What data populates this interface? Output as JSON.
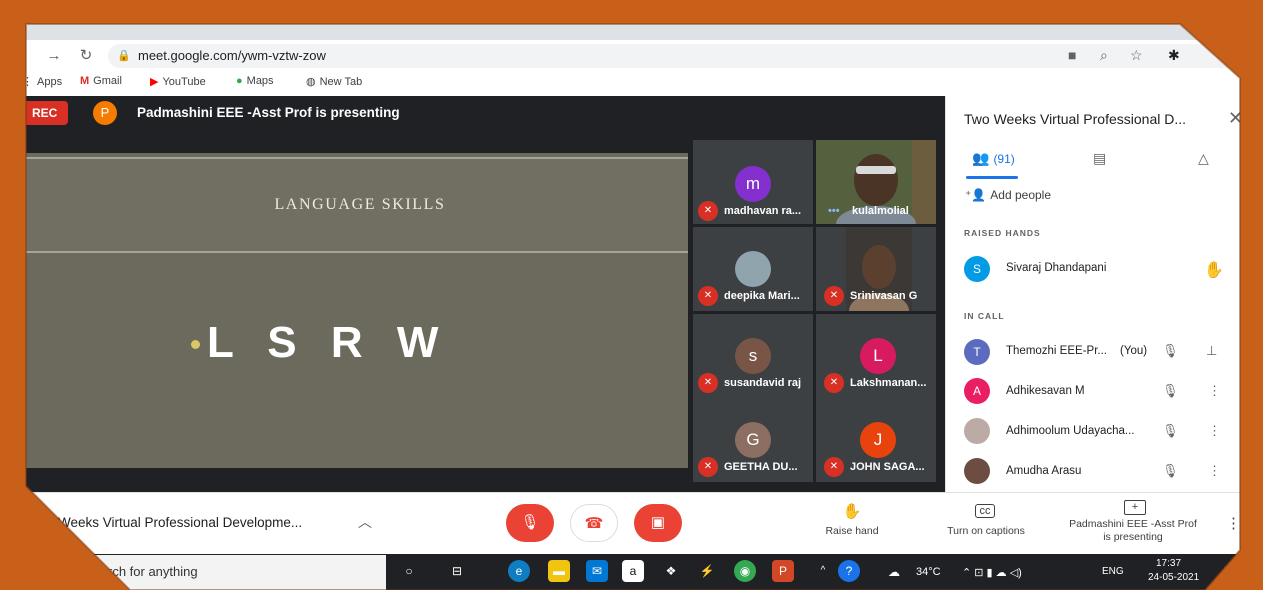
{
  "browser": {
    "url": "meet.google.com/ywm-vztw-zow",
    "bookmarks": [
      "Apps",
      "Gmail",
      "YouTube",
      "Maps",
      "New Tab"
    ]
  },
  "meet": {
    "rec_label": "REC",
    "presenter_initial": "P",
    "presenter_text": "Padmashini EEE -Asst Prof is presenting",
    "slide": {
      "title": "LANGUAGE SKILLS",
      "bullet": "L S R W"
    },
    "tiles": [
      {
        "initial": "m",
        "name": "madhavan ra...",
        "color": "#8430ce"
      },
      {
        "initial": "",
        "name": "kulalmolial",
        "color": ""
      },
      {
        "initial": "",
        "name": "deepika Mari...",
        "color": ""
      },
      {
        "initial": "",
        "name": "Srinivasan G",
        "color": ""
      },
      {
        "initial": "s",
        "name": "susandavid raj",
        "color": "#795548"
      },
      {
        "initial": "L",
        "name": "Lakshmanan...",
        "color": "#d81b60"
      },
      {
        "initial": "G",
        "name": "GEETHA DU...",
        "color": "#8d6e63"
      },
      {
        "initial": "J",
        "name": "JOHN SAGA...",
        "color": "#e8430c"
      }
    ]
  },
  "panel": {
    "title": "Two Weeks Virtual Professional D...",
    "people_count": "(91)",
    "add_people": "Add people",
    "raised_hands_label": "RAISED HANDS",
    "raised": [
      {
        "initial": "S",
        "name": "Sivaraj Dhandapani",
        "color": "#039be5"
      }
    ],
    "in_call_label": "IN CALL",
    "in_call": [
      {
        "initial": "T",
        "name": "Themozhi EEE-Pr...",
        "suffix": "(You)",
        "color": "#5c6bc0"
      },
      {
        "initial": "A",
        "name": "Adhikesavan M",
        "suffix": "",
        "color": "#e91e63"
      },
      {
        "initial": "",
        "name": "Adhimoolum Udayacha...",
        "suffix": "",
        "color": "#bcaaa4"
      },
      {
        "initial": "",
        "name": "Amudha Arasu",
        "suffix": "",
        "color": "#6d4c41"
      }
    ]
  },
  "bottom_bar": {
    "meeting_title": "Weeks Virtual Professional Developme...",
    "raise_hand": "Raise hand",
    "captions": "Turn on captions",
    "presenting_line1": "Padmashini EEE -Asst Prof",
    "presenting_line2": "is presenting"
  },
  "taskbar": {
    "search_text": "rch for anything",
    "temperature": "34°C",
    "language": "ENG",
    "time": "17:37",
    "date": "24-05-2021"
  },
  "colors": {
    "frame": "#c8601a",
    "meet_dark": "#202124",
    "rec_red": "#d93025",
    "accent_blue": "#1a73e8"
  }
}
